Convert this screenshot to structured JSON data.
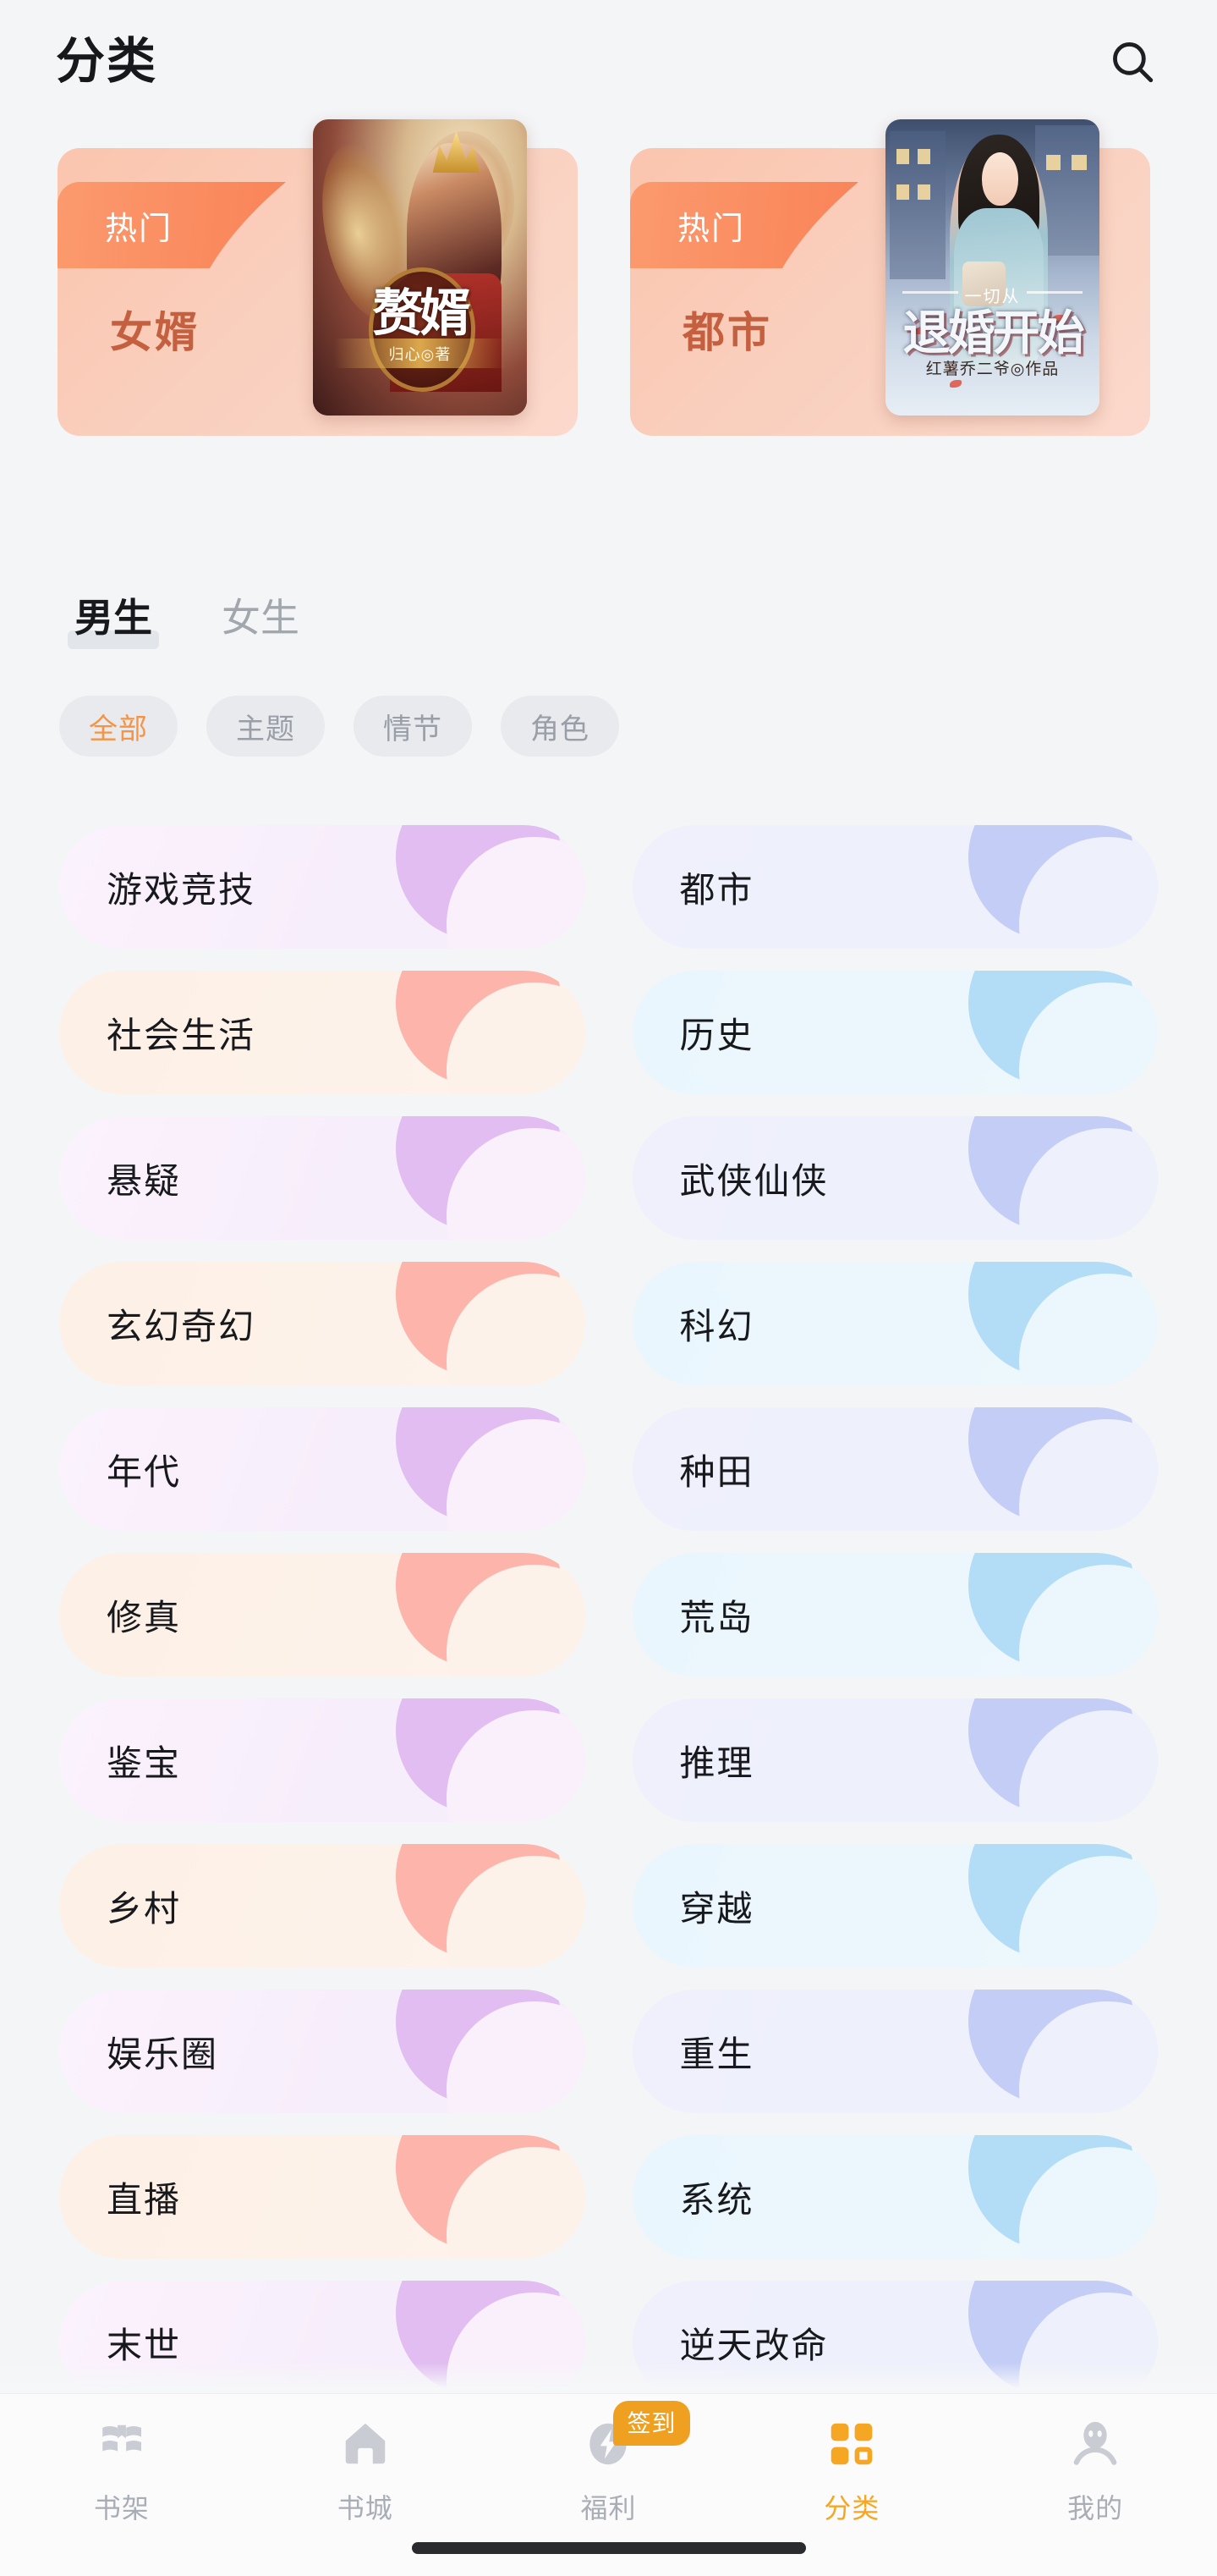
{
  "header": {
    "title": "分类",
    "search_icon": "search-icon"
  },
  "banners": [
    {
      "badge": "热门",
      "category": "女婿",
      "cover_title": "赘婿",
      "cover_author": "归心◎著",
      "cover_top_text": ""
    },
    {
      "badge": "热门",
      "category": "都市",
      "cover_title": "退婚开始",
      "cover_author": "红薯乔二爷◎作品",
      "cover_top_text": "一切从"
    }
  ],
  "gender_tabs": [
    {
      "label": "男生",
      "active": true
    },
    {
      "label": "女生",
      "active": false
    }
  ],
  "filter_chips": [
    {
      "label": "全部",
      "active": true
    },
    {
      "label": "主题",
      "active": false
    },
    {
      "label": "情节",
      "active": false
    },
    {
      "label": "角色",
      "active": false
    }
  ],
  "categories": [
    {
      "label": "游戏竞技",
      "variant": "v-lav"
    },
    {
      "label": "都市",
      "variant": "v-peri"
    },
    {
      "label": "社会生活",
      "variant": "v-peach"
    },
    {
      "label": "历史",
      "variant": "v-blue"
    },
    {
      "label": "悬疑",
      "variant": "v-lav"
    },
    {
      "label": "武侠仙侠",
      "variant": "v-peri"
    },
    {
      "label": "玄幻奇幻",
      "variant": "v-peach"
    },
    {
      "label": "科幻",
      "variant": "v-blue"
    },
    {
      "label": "年代",
      "variant": "v-lav"
    },
    {
      "label": "种田",
      "variant": "v-peri"
    },
    {
      "label": "修真",
      "variant": "v-peach"
    },
    {
      "label": "荒岛",
      "variant": "v-blue"
    },
    {
      "label": "鉴宝",
      "variant": "v-lav"
    },
    {
      "label": "推理",
      "variant": "v-peri"
    },
    {
      "label": "乡村",
      "variant": "v-peach"
    },
    {
      "label": "穿越",
      "variant": "v-blue"
    },
    {
      "label": "娱乐圈",
      "variant": "v-lav"
    },
    {
      "label": "重生",
      "variant": "v-peri"
    },
    {
      "label": "直播",
      "variant": "v-peach"
    },
    {
      "label": "系统",
      "variant": "v-blue"
    },
    {
      "label": "末世",
      "variant": "v-lav"
    },
    {
      "label": "逆天改命",
      "variant": "v-peri"
    }
  ],
  "bottom_nav": {
    "items": [
      {
        "label": "书架",
        "icon": "bookshelf-icon",
        "active": false
      },
      {
        "label": "书城",
        "icon": "home-icon",
        "active": false
      },
      {
        "label": "福利",
        "icon": "bolt-icon",
        "active": false,
        "badge": "签到"
      },
      {
        "label": "分类",
        "icon": "grid-icon",
        "active": true
      },
      {
        "label": "我的",
        "icon": "person-icon",
        "active": false
      }
    ]
  },
  "colors": {
    "background": "#f4f5f7",
    "accent_orange": "#f5a623",
    "chip_active": "#f59444",
    "banner_gradient_start": "#fbc5ae",
    "ribbon_orange": "#fa8a5e",
    "banner_category_text": "#c4603f",
    "nav_inactive": "#a9adb5",
    "badge_orange": "#f0a020"
  }
}
